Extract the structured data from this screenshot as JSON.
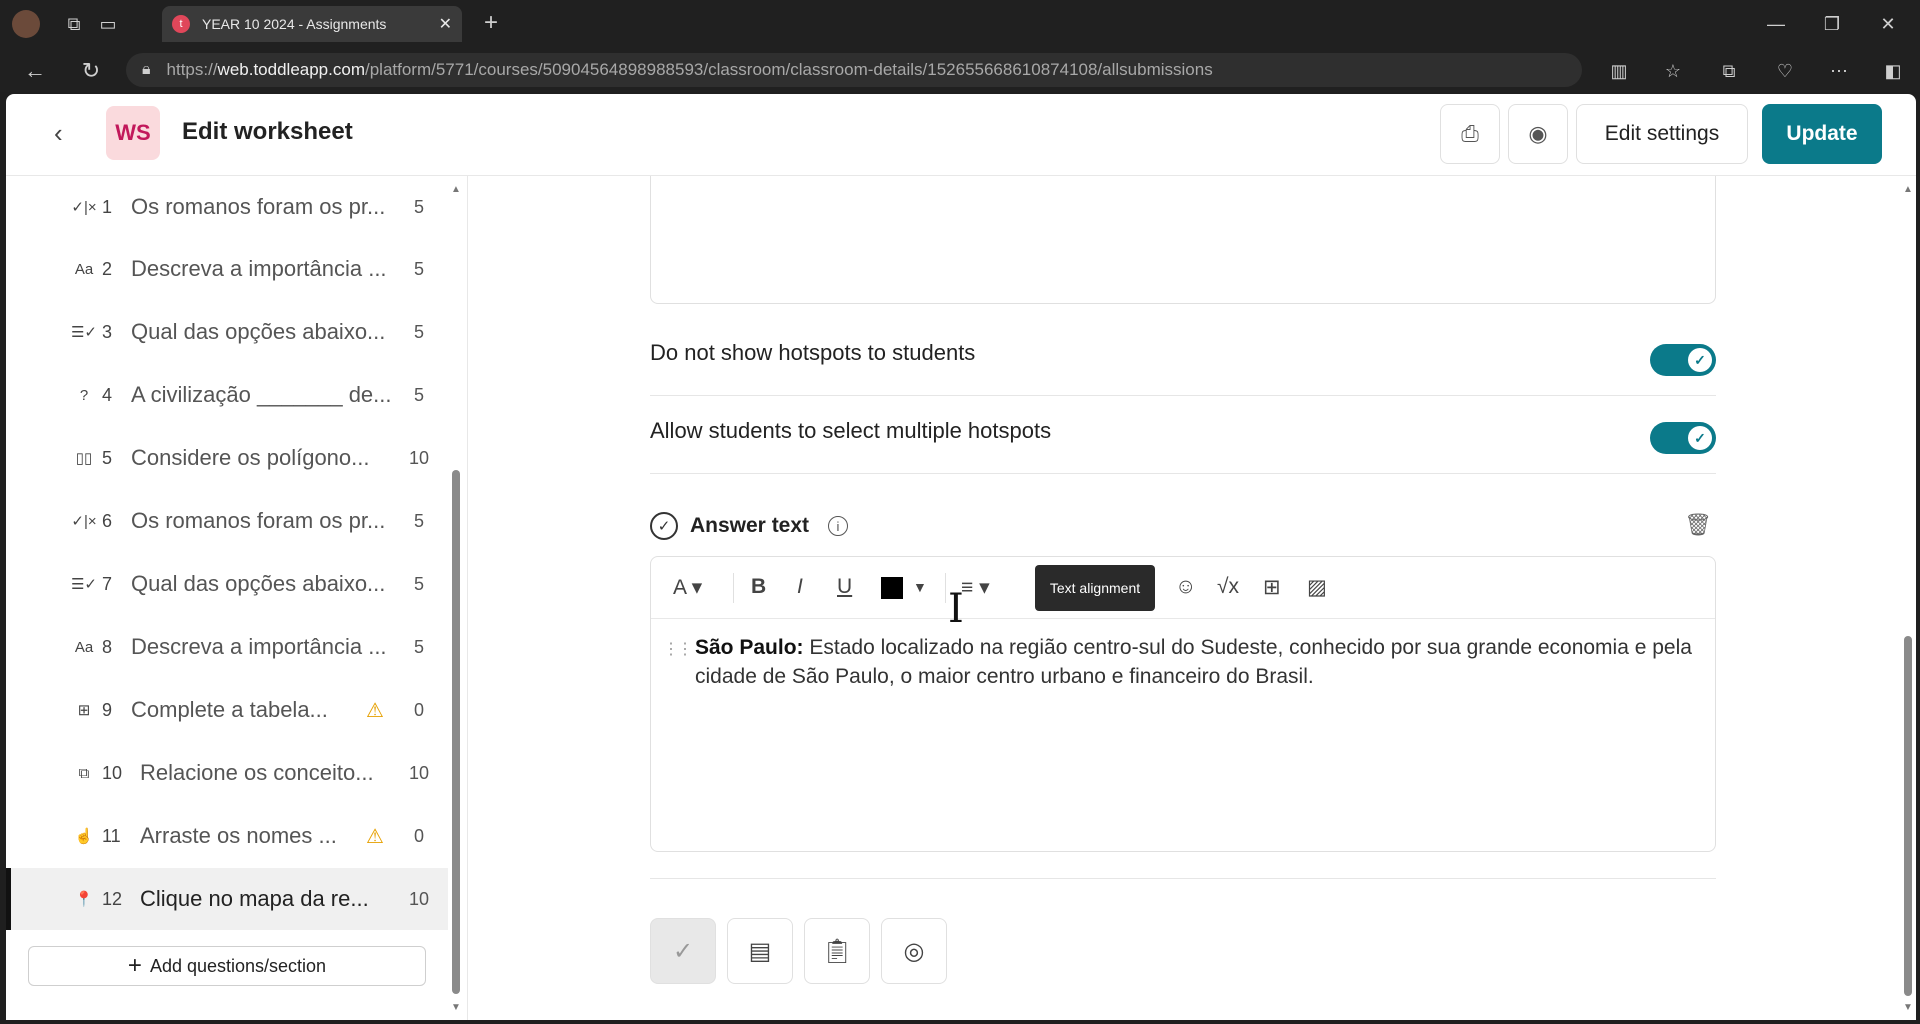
{
  "browser": {
    "tab_title": "YEAR 10 2024 - Assignments",
    "tab_favicon": "t",
    "tab_close": "✕",
    "new_tab": "+",
    "url_prefix": "https://",
    "url_domain": "web.toddleapp.com",
    "url_path": "/platform/5771/courses/50904564898988593/classroom/classroom-details/152655668610874108/allsubmissions"
  },
  "header": {
    "badge": "WS",
    "title": "Edit worksheet",
    "edit_settings_label": "Edit settings",
    "update_label": "Update"
  },
  "sidebar": {
    "items": [
      {
        "icon": "✓|×",
        "num": "1",
        "text": "Os romanos foram os pr...",
        "score": "5"
      },
      {
        "icon": "Aa",
        "num": "2",
        "text": "Descreva a importância ...",
        "score": "5"
      },
      {
        "icon": "☰✓",
        "num": "3",
        "text": "Qual das opções abaixo...",
        "score": "5"
      },
      {
        "icon": "?",
        "num": "4",
        "text": "A civilização _______ de...",
        "score": "5"
      },
      {
        "icon": "▯▯",
        "num": "5",
        "text": "Considere os polígono...",
        "score": "10"
      },
      {
        "icon": "✓|×",
        "num": "6",
        "text": "Os romanos foram os pr...",
        "score": "5"
      },
      {
        "icon": "☰✓",
        "num": "7",
        "text": "Qual das opções abaixo...",
        "score": "5"
      },
      {
        "icon": "Aa",
        "num": "8",
        "text": "Descreva a importância ...",
        "score": "5"
      },
      {
        "icon": "⊞",
        "num": "9",
        "text": "Complete a tabela...",
        "score": "0",
        "warning": "⚠"
      },
      {
        "icon": "⧉",
        "num": "10",
        "text": "Relacione os conceito...",
        "score": "10"
      },
      {
        "icon": "☝",
        "num": "11",
        "text": "Arraste os nomes ...",
        "score": "0",
        "warning": "⚠"
      },
      {
        "icon": "📍",
        "num": "12",
        "text": "Clique no mapa da re...",
        "score": "10"
      }
    ],
    "add_label": "Add questions/section"
  },
  "main": {
    "toggles": [
      {
        "label": "Do not show hotspots to students",
        "on": true
      },
      {
        "label": "Allow students to select multiple hotspots",
        "on": true
      }
    ],
    "answer_title": "Answer text",
    "tooltip": "Text alignment",
    "answer_bold": "São Paulo:",
    "answer_body": " Estado localizado na região centro-sul do Sudeste, conhecido por sua grande economia e pela cidade de São Paulo, o maior centro urbano e financeiro do Brasil."
  },
  "colors": {
    "accent": "#0b7a8a",
    "badge_bg": "#fadadd",
    "badge_fg": "#c2185b",
    "warning": "#e6a000"
  }
}
